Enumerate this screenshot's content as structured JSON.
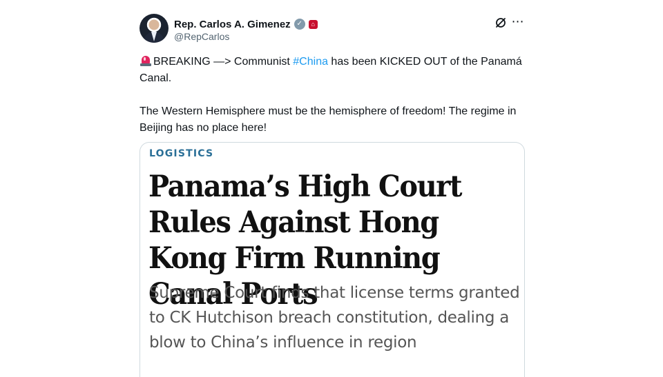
{
  "author": {
    "display_name": "Rep. Carlos A. Gimenez",
    "handle": "@RepCarlos",
    "verified_badge": "verified-check",
    "affiliate_badge": "house-seal"
  },
  "header_icons": {
    "grok": "grok-icon",
    "more": "⋯"
  },
  "tweet": {
    "line1_prefix": "BREAKING —> Communist ",
    "hashtag": "#China",
    "line1_suffix": " has been KICKED OUT of the Panamá Canal.",
    "line2": "The Western Hemisphere must be the hemisphere of freedom! The regime in Beijing has no place here!",
    "hashtag_color": "#1d9bf0"
  },
  "card": {
    "category": "LOGISTICS",
    "headline": "Panama’s High Court Rules Against Hong Kong Firm Running Canal Ports",
    "subheadline": "Supreme Court finds that license terms granted to CK Hutchison breach constitution, dealing a blow to China’s influence in region",
    "category_color": "#2a6f97"
  }
}
